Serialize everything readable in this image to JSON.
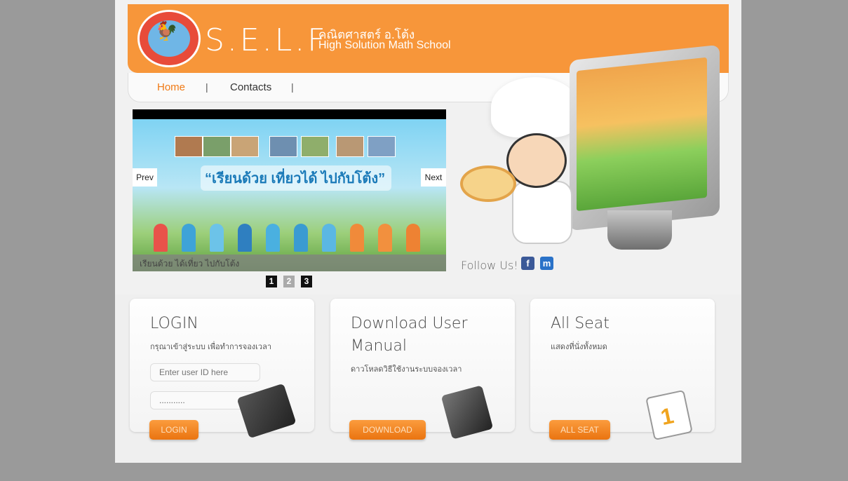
{
  "header": {
    "brand": "S.E.L.F",
    "thai_name": "คณิตศาสตร์ อ.โต้ง",
    "english_name": "High Solution Math School"
  },
  "nav": {
    "items": [
      {
        "label": "Home"
      },
      {
        "label": "Contacts"
      }
    ],
    "separator": "|"
  },
  "slider": {
    "headline": "“เรียนด้วย เที่ยวได้ ไปกับโต้ง”",
    "prev_label": "Prev",
    "next_label": "Next",
    "caption": "เรียนด้วย ได้เที่ยว ไปกับโต้ง",
    "pages": [
      "1",
      "2",
      "3"
    ],
    "active_page": "2"
  },
  "follow": {
    "label": "Follow Us!",
    "facebook_icon": "facebook-icon",
    "myspace_icon": "myspace-icon"
  },
  "cards": {
    "login": {
      "title": "LOGIN",
      "description": "กรุณาเข้าสู่ระบบ เพื่อทำการจองเวลา",
      "user_placeholder": "Enter user ID here",
      "password_value": "...........",
      "button": "LOGIN"
    },
    "download": {
      "title": "Download User Manual",
      "description": "ดาวโหลดวิธีใช้งานระบบจองเวลา",
      "button": "DOWNLOAD"
    },
    "seat": {
      "title": "All Seat",
      "description": "แสดงที่นั่งทั้งหมด",
      "button": "ALL SEAT",
      "calendar_number": "1"
    }
  },
  "colors": {
    "accent": "#f7963a",
    "background": "#9a9a9a"
  }
}
